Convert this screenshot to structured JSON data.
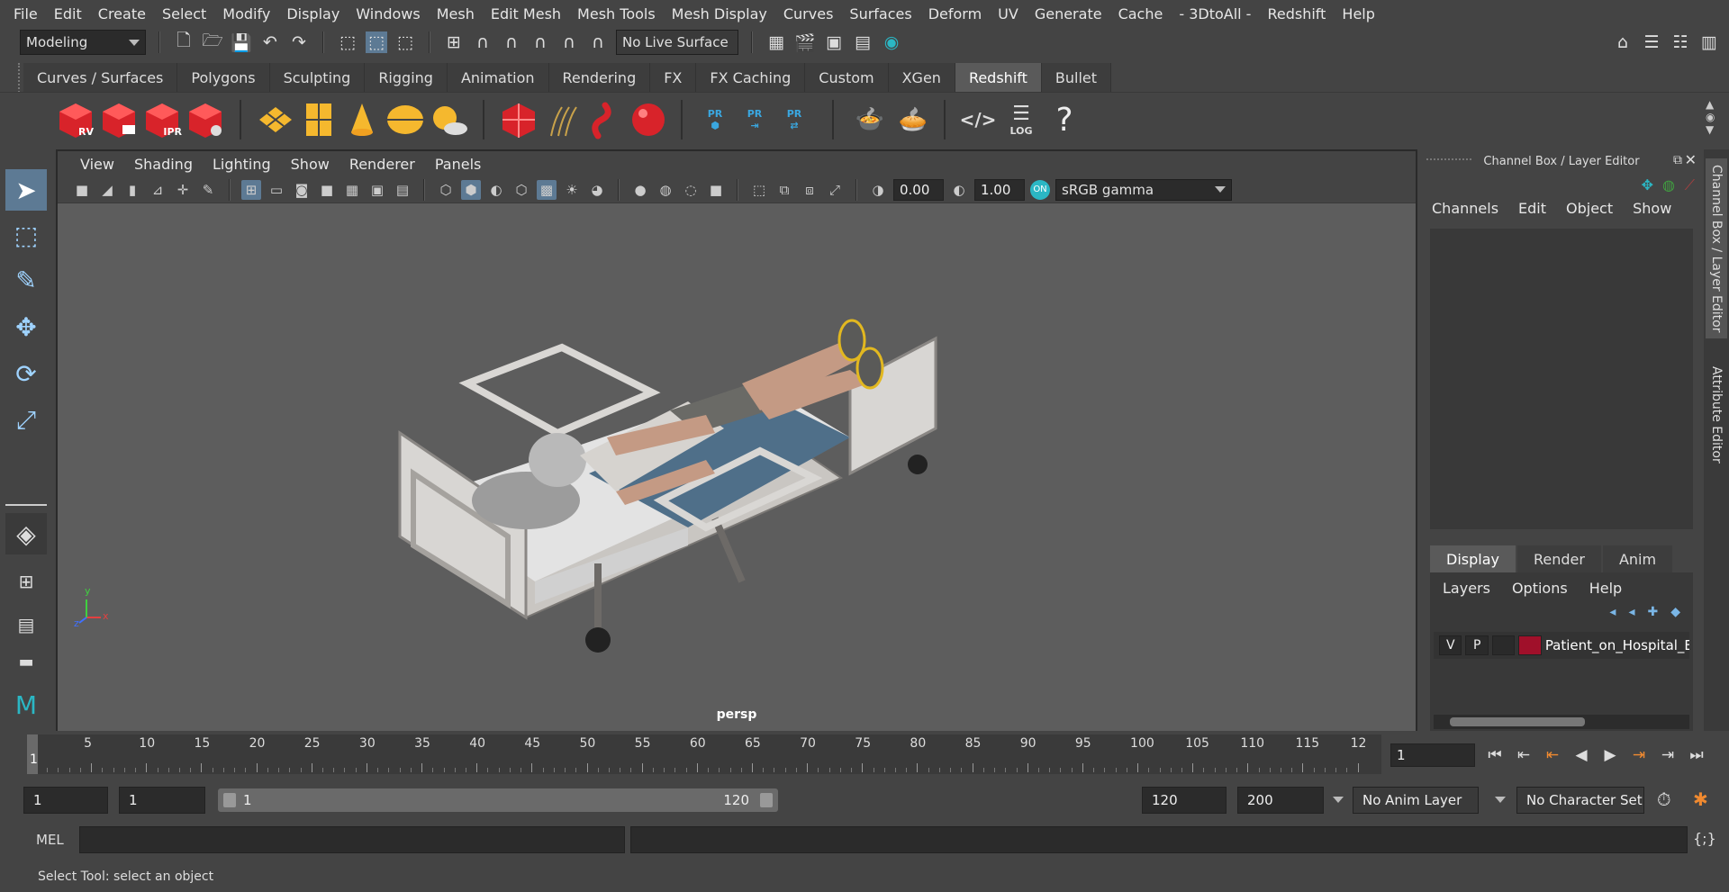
{
  "menubar": [
    "File",
    "Edit",
    "Create",
    "Select",
    "Modify",
    "Display",
    "Windows",
    "Mesh",
    "Edit Mesh",
    "Mesh Tools",
    "Mesh Display",
    "Curves",
    "Surfaces",
    "Deform",
    "UV",
    "Generate",
    "Cache",
    "- 3DtoAll -",
    "Redshift",
    "Help"
  ],
  "statusline": {
    "menuset": "Modeling",
    "live_surface": "No Live Surface"
  },
  "shelf": {
    "tabs": [
      "Curves / Surfaces",
      "Polygons",
      "Sculpting",
      "Rigging",
      "Animation",
      "Rendering",
      "FX",
      "FX Caching",
      "Custom",
      "XGen",
      "Redshift",
      "Bullet"
    ],
    "active_tab": "Redshift",
    "icon_labels": {
      "rv": "RV",
      "ipr": "IPR",
      "pr": "PR",
      "log": "LOG"
    }
  },
  "viewport": {
    "menus": [
      "View",
      "Shading",
      "Lighting",
      "Show",
      "Renderer",
      "Panels"
    ],
    "exposure": "0.00",
    "gamma": "1.00",
    "colorspace": "sRGB gamma",
    "camera_label": "persp",
    "axis": {
      "x": "x",
      "y": "y",
      "z": "z"
    }
  },
  "channel_box": {
    "title": "Channel Box / Layer Editor",
    "menus": [
      "Channels",
      "Edit",
      "Object",
      "Show"
    ]
  },
  "layer_editor": {
    "tabs": [
      "Display",
      "Render",
      "Anim"
    ],
    "active_tab": "Display",
    "menus": [
      "Layers",
      "Options",
      "Help"
    ],
    "layer": {
      "visible": "V",
      "playback": "P",
      "name": "Patient_on_Hospital_B",
      "color": "#a0102a"
    }
  },
  "side_tabs": [
    "Channel Box / Layer Editor",
    "Attribute Editor"
  ],
  "timeslider": {
    "ticks": [
      "5",
      "10",
      "15",
      "20",
      "25",
      "30",
      "35",
      "40",
      "45",
      "50",
      "55",
      "60",
      "65",
      "70",
      "75",
      "80",
      "85",
      "90",
      "95",
      "100",
      "105",
      "110",
      "115",
      "12"
    ],
    "start_label": "1",
    "current_frame": "1"
  },
  "range": {
    "start": "1",
    "playback_start": "1",
    "slider_start": "1",
    "slider_end": "120",
    "playback_end": "120",
    "end": "200",
    "anim_layer": "No Anim Layer",
    "character_set": "No Character Set"
  },
  "command": {
    "lang": "MEL"
  },
  "helpline": "Select Tool: select an object",
  "colors": {
    "accent": "#5d7a94",
    "redshift_red": "#d8232a",
    "layer_color": "#a0102a",
    "maya_teal": "#2bb7c4"
  }
}
